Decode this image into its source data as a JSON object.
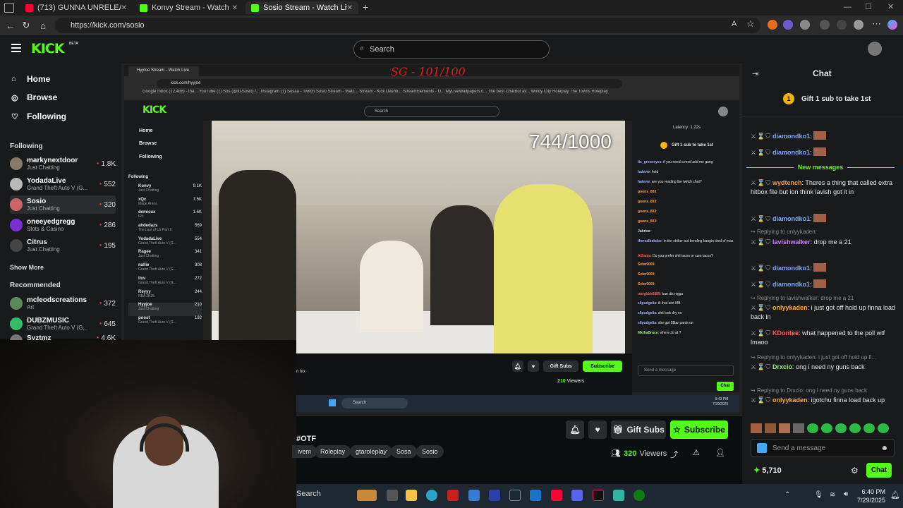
{
  "browser": {
    "tabs": [
      {
        "title": "(713) GUNNA UNRELEASED IN MY",
        "color": "#ff0033",
        "active": false
      },
      {
        "title": "Konvy Stream - Watch Live on",
        "color": "#53fc18",
        "active": false
      },
      {
        "title": "Sosio Stream - Watch Live on Kick",
        "color": "#53fc18",
        "active": true
      }
    ],
    "url": "https://kick.com/sosio",
    "new_tab": "+"
  },
  "header": {
    "logo": "KICK",
    "logo_tag": "BETA",
    "search_placeholder": "Search"
  },
  "sidebar": {
    "nav": [
      {
        "label": "Home",
        "icon": "home-icon"
      },
      {
        "label": "Browse",
        "icon": "compass-icon"
      },
      {
        "label": "Following",
        "icon": "heart-icon"
      }
    ],
    "following_title": "Following",
    "following": [
      {
        "name": "markynextdoor",
        "category": "Just Chatting",
        "viewers": "1.8K"
      },
      {
        "name": "YodadaLive",
        "category": "Grand Theft Auto V (G...",
        "viewers": "552"
      },
      {
        "name": "Sosio",
        "category": "Just Chatting",
        "viewers": "320"
      },
      {
        "name": "oneeyedgregg",
        "category": "Slots & Casino",
        "viewers": "286"
      },
      {
        "name": "Citrus",
        "category": "Just Chatting",
        "viewers": "195"
      }
    ],
    "show_more": "Show More",
    "recommended_title": "Recommended",
    "recommended": [
      {
        "name": "mcleodscreations",
        "category": "Art",
        "viewers": "372"
      },
      {
        "name": "DUBZMUSIC",
        "category": "Grand Theft Auto V (G...",
        "viewers": "645"
      },
      {
        "name": "Syztmz",
        "category": "",
        "viewers": "4.6K"
      }
    ]
  },
  "overlay": {
    "watermark": "SG - 101/100",
    "counter": "744/1000"
  },
  "inner": {
    "tab_title": "Hyyloe Stream - Watch Live",
    "url": "kick.com/hyyjoe",
    "bookmarks": "Google   Inbox (12,488) - tha...   YouTube   (1) Sos (@ItsSosio) /...   Instagram   (1) Sosaa - Twitch   Sosio Stream - Watc...   Stream - Kick Dashb...   StreamElements - D...   MyLiveWallpapers.c...   The best ChatBot av...   Windy City Roleplay   The Towns Roleplay",
    "logo": "KICK",
    "search": "Search",
    "nav": [
      "Home",
      "Browse",
      "Following"
    ],
    "following_title": "Following",
    "following": [
      {
        "name": "Konvy",
        "category": "Just Chatting",
        "viewers": "9.1K"
      },
      {
        "name": "xQc",
        "category": "Mage Arena",
        "viewers": "7.5K"
      },
      {
        "name": "demisux",
        "category": "IRL",
        "viewers": "1.6K"
      },
      {
        "name": "ahdedazs",
        "category": "The Last of Us Part II",
        "viewers": "569"
      },
      {
        "name": "YodadaLive",
        "category": "Grand Theft Auto V (G...",
        "viewers": "554"
      },
      {
        "name": "Ragee",
        "category": "Just Chatting",
        "viewers": "341"
      },
      {
        "name": "nallie",
        "category": "Grand Theft Auto V (G...",
        "viewers": "308"
      },
      {
        "name": "iluv",
        "category": "Grand Theft Auto V (G...",
        "viewers": "272"
      },
      {
        "name": "Reyyy",
        "category": "NBA 2K25",
        "viewers": "244"
      },
      {
        "name": "Hyyjoe",
        "category": "Just Chatting",
        "viewers": "210"
      },
      {
        "name": "poost",
        "category": "Grand Theft Auto V (G...",
        "viewers": "192"
      }
    ],
    "latency": "Latency: 1.22s",
    "gift_banner": "Gift 1 sub to take 1st",
    "chat_lines": [
      {
        "user": "its_greeneyes",
        "text": "if you need a mod add me gang"
      },
      {
        "user": "hatevw",
        "text": "hold"
      },
      {
        "user": "hatevw",
        "text": "are you reading the twitch chat?"
      },
      {
        "user": "goons_803",
        "text": ""
      },
      {
        "user": "goons_803",
        "text": ""
      },
      {
        "user": "goons_803",
        "text": ""
      },
      {
        "user": "goons_803",
        "text": ""
      },
      {
        "user": "Jabriee",
        "text": ""
      },
      {
        "user": "therealbckdoe",
        "text": "in the striker out bending bangin tired of mas"
      },
      {
        "user": "AlSanja",
        "text": "Do you prefer shit tacos or cum tacos?"
      },
      {
        "user": "Sebo9009",
        "text": ""
      },
      {
        "user": "Sebo9009",
        "text": ""
      },
      {
        "user": "Sebo9009",
        "text": ""
      },
      {
        "user": "uizigbbh6889",
        "text": "ban dis nigga"
      },
      {
        "user": "slipudgelia",
        "text": "ik that aint MB"
      },
      {
        "user": "slipudgelia",
        "text": "shit look dry no"
      },
      {
        "user": "slipudgelia",
        "text": "she got 5$tar pants on"
      },
      {
        "user": "MkthaBruce",
        "text": "where Jo at ?"
      }
    ],
    "send_placeholder": "Send a message",
    "chat_button": "Chat",
    "gift_subs": "Gift Subs",
    "subscribe": "Subscribe",
    "viewers": "210",
    "viewers_label": "Viewers",
    "stream_sub": "n htx",
    "taskbar_search": "Search",
    "time": "9:43 PM",
    "date": "7/29/2025"
  },
  "stream": {
    "title_fragment": "#OTF",
    "tags": [
      "ivem",
      "Roleplay",
      "gtaroleplay",
      "Sosa",
      "Sosio"
    ],
    "gift_subs": "Gift Subs",
    "subscribe": "Subscribe",
    "viewers": "320",
    "viewers_label": "Viewers"
  },
  "chat": {
    "title": "Chat",
    "gift_banner": "Gift 1 sub to take 1st",
    "new_messages": "New messages",
    "messages": [
      {
        "kind": "msg",
        "user": "diamondko1",
        "color": "#7aa7ff",
        "text": "",
        "emote": true
      },
      {
        "kind": "msg",
        "user": "diamondko1",
        "color": "#7aa7ff",
        "text": "",
        "emote": true
      },
      {
        "kind": "msg",
        "user": "wydtench",
        "color": "#ff9a3c",
        "text": "Theres a thing that called extra hitbox file but ion think lavish got it in"
      },
      {
        "kind": "msg",
        "user": "diamondko1",
        "color": "#7aa7ff",
        "text": "",
        "emote": true
      },
      {
        "kind": "reply",
        "text": "Replying to onlyykaden:"
      },
      {
        "kind": "msg",
        "user": "lavishwalker",
        "color": "#c77dff",
        "text": "drop me a 21"
      },
      {
        "kind": "msg",
        "user": "diamondko1",
        "color": "#7aa7ff",
        "text": "",
        "emote": true
      },
      {
        "kind": "msg",
        "user": "diamondko1",
        "color": "#7aa7ff",
        "text": "",
        "emote": true
      },
      {
        "kind": "reply",
        "text": "Replying to lavishwalker: drop me a 21"
      },
      {
        "kind": "msg",
        "user": "onlyykaden",
        "color": "#ffb020",
        "text": "i just got off hold up finna load back in"
      },
      {
        "kind": "msg",
        "user": "KDontee",
        "color": "#ff5a5a",
        "text": "what happened to the poll wtf lmaoo"
      },
      {
        "kind": "reply",
        "text": "Replying to onlyykaden: i just got off hold up fi..."
      },
      {
        "kind": "msg",
        "user": "Drxcio",
        "color": "#9fe870",
        "text": "ong i need ny guns back"
      },
      {
        "kind": "reply",
        "text": "Replying to Drxcio: ong i need ny guns back"
      },
      {
        "kind": "msg",
        "user": "onlyykaden",
        "color": "#ffb020",
        "text": "igotchu finna load back up"
      }
    ],
    "send_placeholder": "Send a message",
    "points": "5,710",
    "chat_button": "Chat"
  },
  "taskbar": {
    "search": "Search",
    "time": "6:40 PM",
    "date": "7/29/2025"
  },
  "colors": {
    "accent": "#53fc18",
    "bg": "#0b0e0f",
    "panel": "#181a1b",
    "live": "#ea3a3a"
  }
}
